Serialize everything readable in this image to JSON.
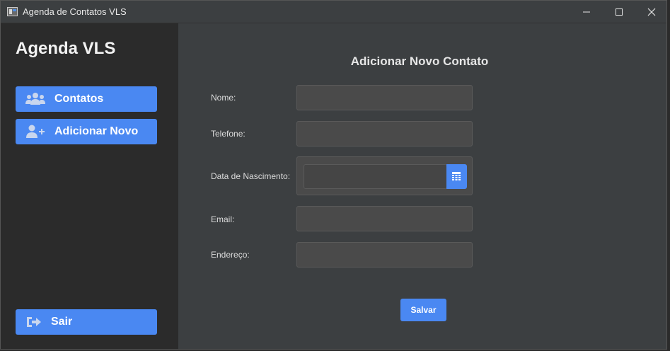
{
  "window": {
    "title": "Agenda de Contatos VLS"
  },
  "sidebar": {
    "brand": "Agenda VLS",
    "items": [
      {
        "label": "Contatos",
        "icon": "users-icon"
      },
      {
        "label": "Adicionar Novo",
        "icon": "user-plus-icon"
      }
    ],
    "logout": {
      "label": "Sair",
      "icon": "sign-out-icon"
    }
  },
  "form": {
    "title": "Adicionar Novo Contato",
    "fields": {
      "nome": {
        "label": "Nome:",
        "value": ""
      },
      "telefone": {
        "label": "Telefone:",
        "value": ""
      },
      "nascimento": {
        "label": "Data de Nascimento:",
        "value": "",
        "icon": "calendar-icon"
      },
      "email": {
        "label": "Email:",
        "value": ""
      },
      "endereco": {
        "label": "Endereço:",
        "value": ""
      }
    },
    "save_label": "Salvar"
  },
  "colors": {
    "accent": "#4a88f2",
    "sidebar_bg": "#2b2b2b",
    "main_bg": "#3c3f41",
    "input_bg": "#4a4a4a"
  }
}
